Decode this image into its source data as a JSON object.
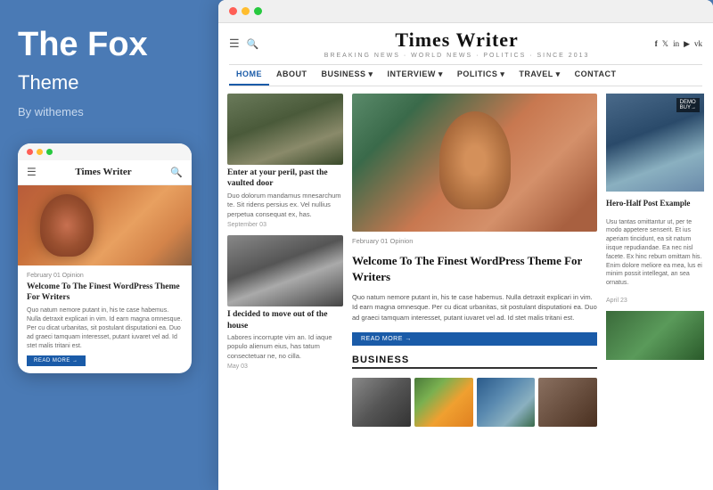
{
  "leftPanel": {
    "title": "The Fox",
    "subtitle": "Theme",
    "author": "By withemes"
  },
  "mobileMockup": {
    "dots": [
      "red",
      "yellow",
      "green"
    ],
    "navTitle": "Times Writer",
    "meta": "February 01    Opinion",
    "articleTitle": "Welcome To The Finest WordPress Theme For Writers",
    "articleText": "Quo natum nemore putant in, his te case habemus. Nulla detraxit explicari in vim. Id earn magna omnesque. Per cu dicat urbanitas, sit postulant disputationi ea. Duo ad graeci tamquam interesset, putant iuvaret vel ad. Id stet malis tritani est.",
    "readMore": "READ MORE →"
  },
  "desktopMockup": {
    "dots": [
      "red",
      "yellow",
      "green"
    ],
    "siteName": "Times Writer",
    "tagline": "BREAKING NEWS · WORLD NEWS · POLITICS · SINCE 2013",
    "nav": [
      {
        "label": "HOME",
        "active": true
      },
      {
        "label": "ABOUT",
        "active": false
      },
      {
        "label": "BUSINESS ▾",
        "active": false
      },
      {
        "label": "INTERVIEW ▾",
        "active": false
      },
      {
        "label": "POLITICS ▾",
        "active": false
      },
      {
        "label": "TRAVEL ▾",
        "active": false
      },
      {
        "label": "CONTACT",
        "active": false
      }
    ],
    "leftArticle1": {
      "title": "Enter at your peril, past the vaulted door",
      "text": "Duo dolorum mandamus mnesarchum te. Sit ridens persius ex. Vel nullius perpetua consequat ex, has.",
      "date": "September 03"
    },
    "leftArticle2": {
      "title": "I decided to move out of the house",
      "text": "Labores incorrupte vim an. Id iaque populo alienum eius, has tatum consectetuar ne, no cilla.",
      "date": "May 03"
    },
    "heroArticle": {
      "meta": "February 01    Opinion",
      "title": "Welcome To The Finest WordPress Theme For Writers",
      "text": "Quo natum nemore putant in, his te case habemus. Nulla detraxit explicari in vim. Id earn magna omnesque. Per cu dicat urbanitas, sit postulant disputationi ea. Duo ad graeci tamquam interesset, putant iuvaret vel ad. Id stet malis tritani est.",
      "readMore": "READ MORE →"
    },
    "businessSection": "BUSINESS",
    "rightArticle": {
      "title": "Hero-Half Post Example",
      "text": "Usu tantas omittantur ut, per te modo appetere senserit. Et ius aperiam tincidunt, ea sit natum iisque repudiandae. Ea nec nisl facete. Ex hinc rebum omittam his. Enim dolore meliore ea mea, lus ei minim possit intellegat, an sea ornatus.",
      "date": "April 23",
      "demoBadge": "DEMO\nBUY→"
    },
    "socialIcons": [
      "f",
      "t",
      "in",
      "yt",
      "vk"
    ]
  }
}
